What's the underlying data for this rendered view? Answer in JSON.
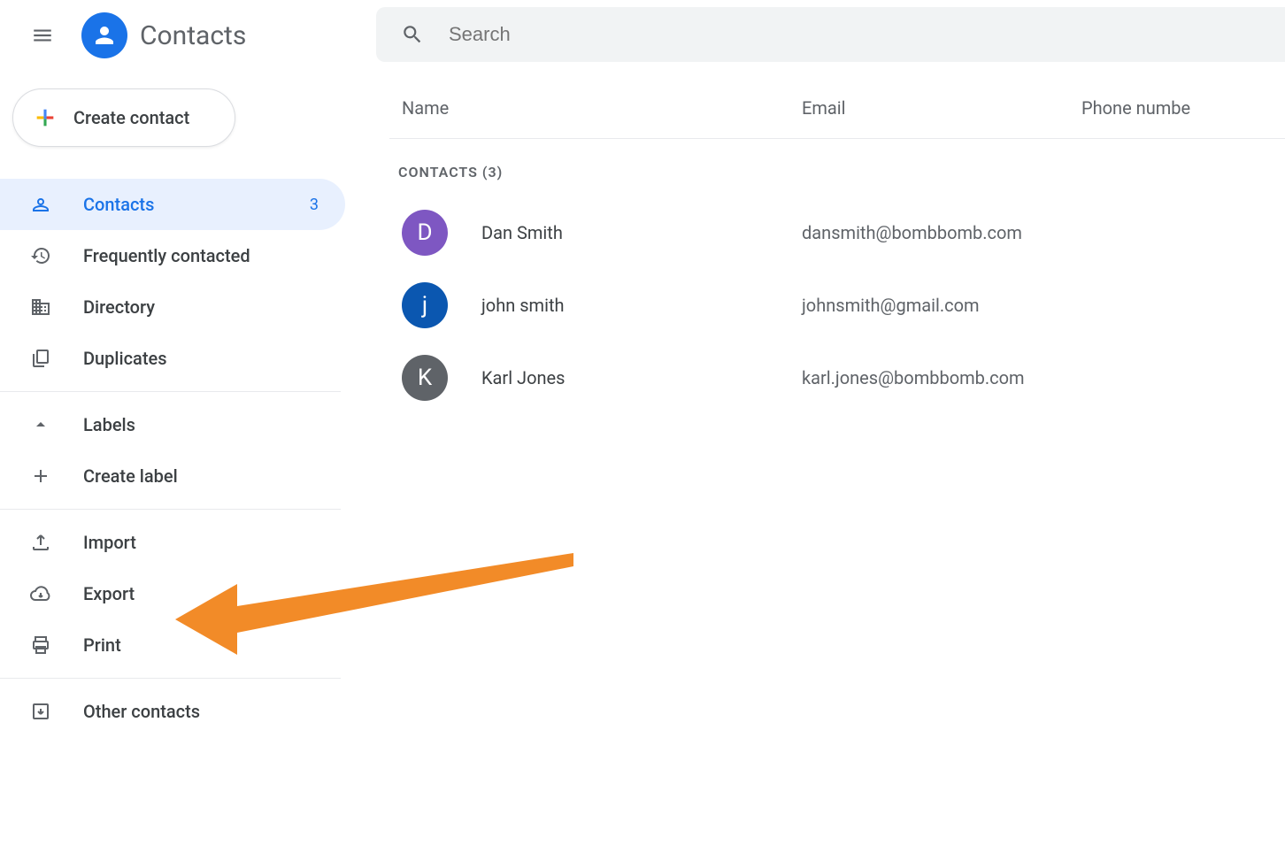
{
  "header": {
    "app_title": "Contacts",
    "search_placeholder": "Search"
  },
  "sidebar": {
    "create_label": "Create contact",
    "items": [
      {
        "label": "Contacts",
        "count": "3",
        "icon": "person",
        "active": true
      },
      {
        "label": "Frequently contacted",
        "icon": "history"
      },
      {
        "label": "Directory",
        "icon": "domain"
      },
      {
        "label": "Duplicates",
        "icon": "content-copy"
      }
    ],
    "labels_header": "Labels",
    "create_label_label": "Create label",
    "actions": [
      {
        "label": "Import",
        "icon": "upload"
      },
      {
        "label": "Export",
        "icon": "cloud-download"
      },
      {
        "label": "Print",
        "icon": "print"
      }
    ],
    "other_contacts_label": "Other contacts"
  },
  "table": {
    "columns": {
      "name": "Name",
      "email": "Email",
      "phone": "Phone numbe"
    },
    "section_label": "CONTACTS (3)",
    "rows": [
      {
        "initial": "D",
        "name": "Dan Smith",
        "email": "dansmith@bombbomb.com",
        "avatar_bg": "#7e57c2"
      },
      {
        "initial": "j",
        "name": "john smith",
        "email": "johnsmith@gmail.com",
        "avatar_bg": "#0b57b0"
      },
      {
        "initial": "K",
        "name": "Karl Jones",
        "email": "karl.jones@bombbomb.com",
        "avatar_bg": "#5f6368"
      }
    ]
  },
  "annotation": {
    "arrow_color": "#f28b28",
    "points_to": "Export"
  }
}
